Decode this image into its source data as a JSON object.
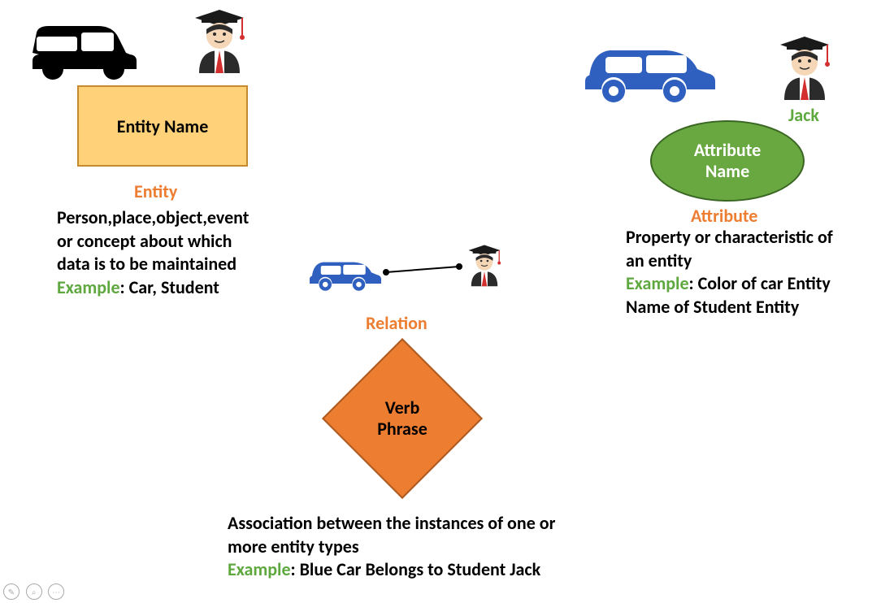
{
  "entity": {
    "shape_label": "Entity Name",
    "title": "Entity",
    "desc1": "Person,place,object,event",
    "desc2": "or concept about which",
    "desc3": "data is to be maintained",
    "example_label": "Example",
    "example_text": ": Car, Student"
  },
  "relation": {
    "shape_label1": "Verb",
    "shape_label2": "Phrase",
    "title": "Relation",
    "desc1": "Association between the instances of one or",
    "desc2": "more entity types",
    "example_label": "Example",
    "example_text": ": Blue Car Belongs to Student Jack"
  },
  "attribute": {
    "jack": "Jack",
    "shape_label1": "Attribute",
    "shape_label2": "Name",
    "title": "Attribute",
    "desc1": "Property or characteristic of",
    "desc2": "an entity",
    "example_label": "Example",
    "example_text_a": ": Color of car Entity",
    "example_text_b": "Name of Student Entity"
  }
}
